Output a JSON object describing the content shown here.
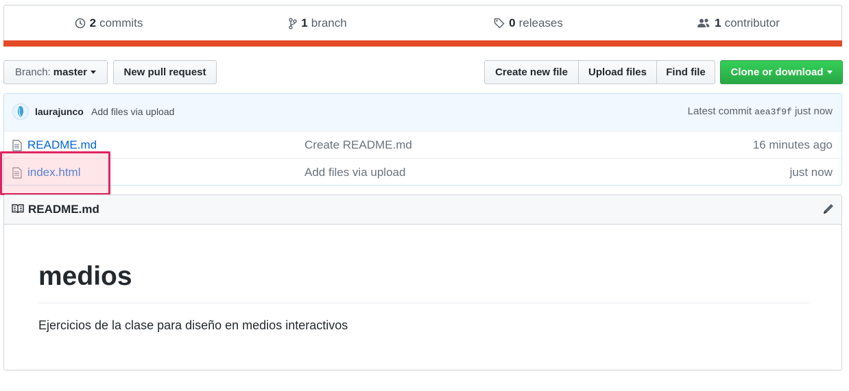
{
  "summary": {
    "commits": {
      "count": "2",
      "label": "commits"
    },
    "branches": {
      "count": "1",
      "label": "branch"
    },
    "releases": {
      "count": "0",
      "label": "releases"
    },
    "contributors": {
      "count": "1",
      "label": "contributor"
    },
    "language_color": "#e34c26"
  },
  "toolbar": {
    "branch_prefix": "Branch:",
    "branch_name": "master",
    "new_pull_request": "New pull request",
    "create_new_file": "Create new file",
    "upload_files": "Upload files",
    "find_file": "Find file",
    "clone_or_download": "Clone or download"
  },
  "latest_commit": {
    "author": "laurajunco",
    "message": "Add files via upload",
    "label": "Latest commit",
    "sha": "aea3f9f",
    "age": "just now"
  },
  "files": [
    {
      "name": "README.md",
      "message": "Create README.md",
      "age": "16 minutes ago"
    },
    {
      "name": "index.html",
      "message": "Add files via upload",
      "age": "just now"
    }
  ],
  "readme": {
    "filename": "README.md",
    "heading": "medios",
    "body": "Ejercicios de la clase para diseño en medios interactivos"
  },
  "colors": {
    "link": "#0366d6",
    "green_button": "#28a745",
    "highlight_border": "#e0245e"
  }
}
